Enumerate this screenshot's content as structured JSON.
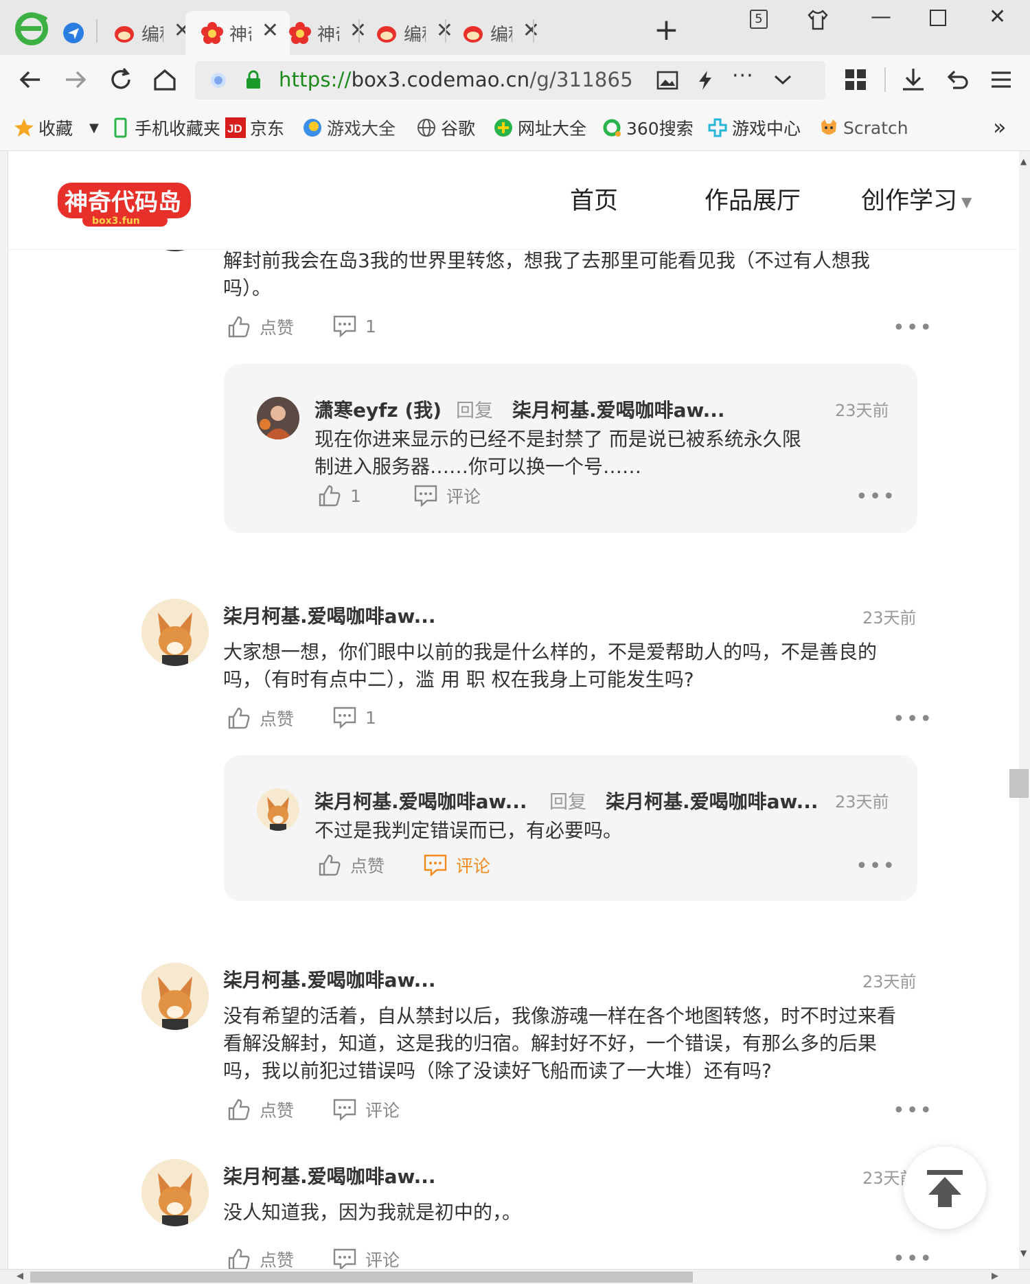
{
  "browser": {
    "tabs": [
      {
        "label": "编程",
        "icon": "codemao-icon",
        "active": false
      },
      {
        "label": "神奇",
        "icon": "box3-flower-icon",
        "active": true
      },
      {
        "label": "神奇",
        "icon": "box3-flower-icon",
        "active": false
      },
      {
        "label": "编程",
        "icon": "codemao-icon",
        "active": false
      },
      {
        "label": "编程",
        "icon": "codemao-icon",
        "active": false
      }
    ],
    "tab_count": "5",
    "url": {
      "scheme": "https://",
      "host": "box3.codemao.cn",
      "path": "/g/311865"
    },
    "bookmarks": [
      {
        "label": "收藏",
        "icon": "star-icon"
      },
      {
        "label": "手机收藏夹",
        "icon": "phone-icon"
      },
      {
        "label": "京东",
        "icon": "jd-icon"
      },
      {
        "label": "游戏大全",
        "icon": "game-ball-icon"
      },
      {
        "label": "谷歌",
        "icon": "globe-icon"
      },
      {
        "label": "网址大全",
        "icon": "plus-circle-icon"
      },
      {
        "label": "360搜索",
        "icon": "search360-icon"
      },
      {
        "label": "游戏中心",
        "icon": "gamepad-icon"
      },
      {
        "label": "Scratch",
        "icon": "scratch-cat-icon"
      }
    ]
  },
  "site": {
    "logo_text": "神奇代码岛",
    "logo_sub": "box3.fun",
    "nav": [
      "首页",
      "作品展厅",
      "创作学习"
    ]
  },
  "comments": [
    {
      "text": "解封前我会在岛3我的世界里转悠，想我了去那里可能看见我（不过有人想我吗）。",
      "like_label": "点赞",
      "comment_count": "1",
      "replies": [
        {
          "author": "潇寒eyfz (我)",
          "reply_word": "回复",
          "reply_to": "柒月柯基.爱喝咖啡aw...",
          "time": "23天前",
          "text": "现在你进来显示的已经不是封禁了 而是说已被系统永久限制进入服务器……你可以换一个号……",
          "like_count": "1",
          "comment_label": "评论"
        }
      ]
    },
    {
      "author": "柒月柯基.爱喝咖啡aw...",
      "time": "23天前",
      "text": "大家想一想，你们眼中以前的我是什么样的，不是爱帮助人的吗，不是善良的吗，（有时有点中二），滥 用 职 权在我身上可能发生吗?",
      "like_label": "点赞",
      "comment_count": "1",
      "replies": [
        {
          "author": "柒月柯基.爱喝咖啡aw...",
          "reply_word": "回复",
          "reply_to": "柒月柯基.爱喝咖啡aw...",
          "time": "23天前",
          "text": "不过是我判定错误而已，有必要吗。",
          "like_label": "点赞",
          "comment_label": "评论"
        }
      ]
    },
    {
      "author": "柒月柯基.爱喝咖啡aw...",
      "time": "23天前",
      "text": "没有希望的活着，自从禁封以后，我像游魂一样在各个地图转悠，时不时过来看看解没解封，知道，这是我的归宿。解封好不好，一个错误，有那么多的后果吗，我以前犯过错误吗（除了没读好飞船而读了一大堆）还有吗?",
      "like_label": "点赞",
      "comment_label": "评论"
    },
    {
      "author": "柒月柯基.爱喝咖啡aw...",
      "time": "23天前",
      "text": "没人知道我，因为我就是初中的，。",
      "like_label": "点赞",
      "comment_label": "评论"
    }
  ],
  "colors": {
    "accent_orange": "#f28a1e",
    "url_green": "#1a8a1a",
    "logo_red": "#e8302a"
  }
}
